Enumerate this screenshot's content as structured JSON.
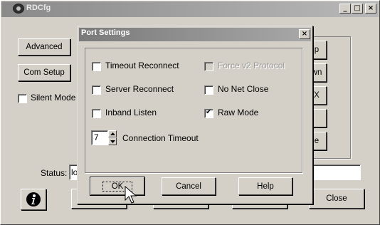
{
  "main_window": {
    "title": "RDCfg",
    "controls": {
      "minimize": "_",
      "maximize": "□",
      "close": "×"
    },
    "buttons": {
      "advanced": "Advanced",
      "com_setup": "Com Setup",
      "close": "Close",
      "right_1": "p",
      "right_2": "wn",
      "right_3": "X",
      "right_5": "e"
    },
    "silent_mode_label": "Silent Mode",
    "silent_mode_checked": false,
    "status_label": "Status:",
    "status_value": "lo"
  },
  "dialog": {
    "title": "Port Settings",
    "close_glyph": "×",
    "options": {
      "timeout_reconnect": {
        "label": "Timeout Reconnect",
        "checked": false
      },
      "server_reconnect": {
        "label": "Server Reconnect",
        "checked": false
      },
      "inband_listen": {
        "label": "Inband Listen",
        "checked": false
      },
      "force_v2": {
        "label": "Force v2 Protocol",
        "checked": false,
        "disabled": true
      },
      "no_net_close": {
        "label": "No Net Close",
        "checked": false
      },
      "raw_mode": {
        "label": "Raw Mode",
        "checked": true
      }
    },
    "connection_timeout": {
      "value": "7",
      "label": "Connection Timeout"
    },
    "buttons": {
      "ok": "OK",
      "cancel": "Cancel",
      "help": "Help"
    }
  }
}
